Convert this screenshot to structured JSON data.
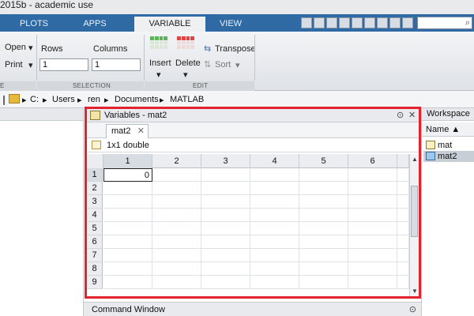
{
  "window": {
    "title": "2015b - academic use"
  },
  "tabs": [
    {
      "label": "PLOTS",
      "active": false
    },
    {
      "label": "APPS",
      "active": false
    },
    {
      "label": "VARIABLE",
      "active": true
    },
    {
      "label": "VIEW",
      "active": false
    }
  ],
  "ribbon": {
    "open_label": "Open",
    "print_label": "Print",
    "rows_label": "Rows",
    "rows_value": "1",
    "columns_label": "Columns",
    "columns_value": "1",
    "insert_label": "Insert",
    "delete_label": "Delete",
    "transpose_label": "Transpose",
    "sort_label": "Sort",
    "group_left": "E",
    "group_selection": "SELECTION",
    "group_edit": "EDIT"
  },
  "address": {
    "separator": "▸",
    "parts": [
      "C:",
      "Users",
      "ren",
      "Documents",
      "MATLAB"
    ]
  },
  "variables_window": {
    "title": "Variables - mat2",
    "tab_label": "mat2",
    "info": "1x1 double",
    "column_headers": [
      "1",
      "2",
      "3",
      "4",
      "5",
      "6"
    ],
    "row_headers": [
      "1",
      "2",
      "3",
      "4",
      "5",
      "6",
      "7",
      "8",
      "9"
    ],
    "cell_value": "0"
  },
  "workspace": {
    "title": "Workspace",
    "column_name": "Name ▲",
    "items": [
      {
        "label": "mat",
        "selected": false
      },
      {
        "label": "mat2",
        "selected": true
      }
    ]
  },
  "command_window": {
    "title": "Command Window"
  },
  "colors": {
    "highlight_border": "#e3232d",
    "tab_strip": "#2f6aa5"
  }
}
